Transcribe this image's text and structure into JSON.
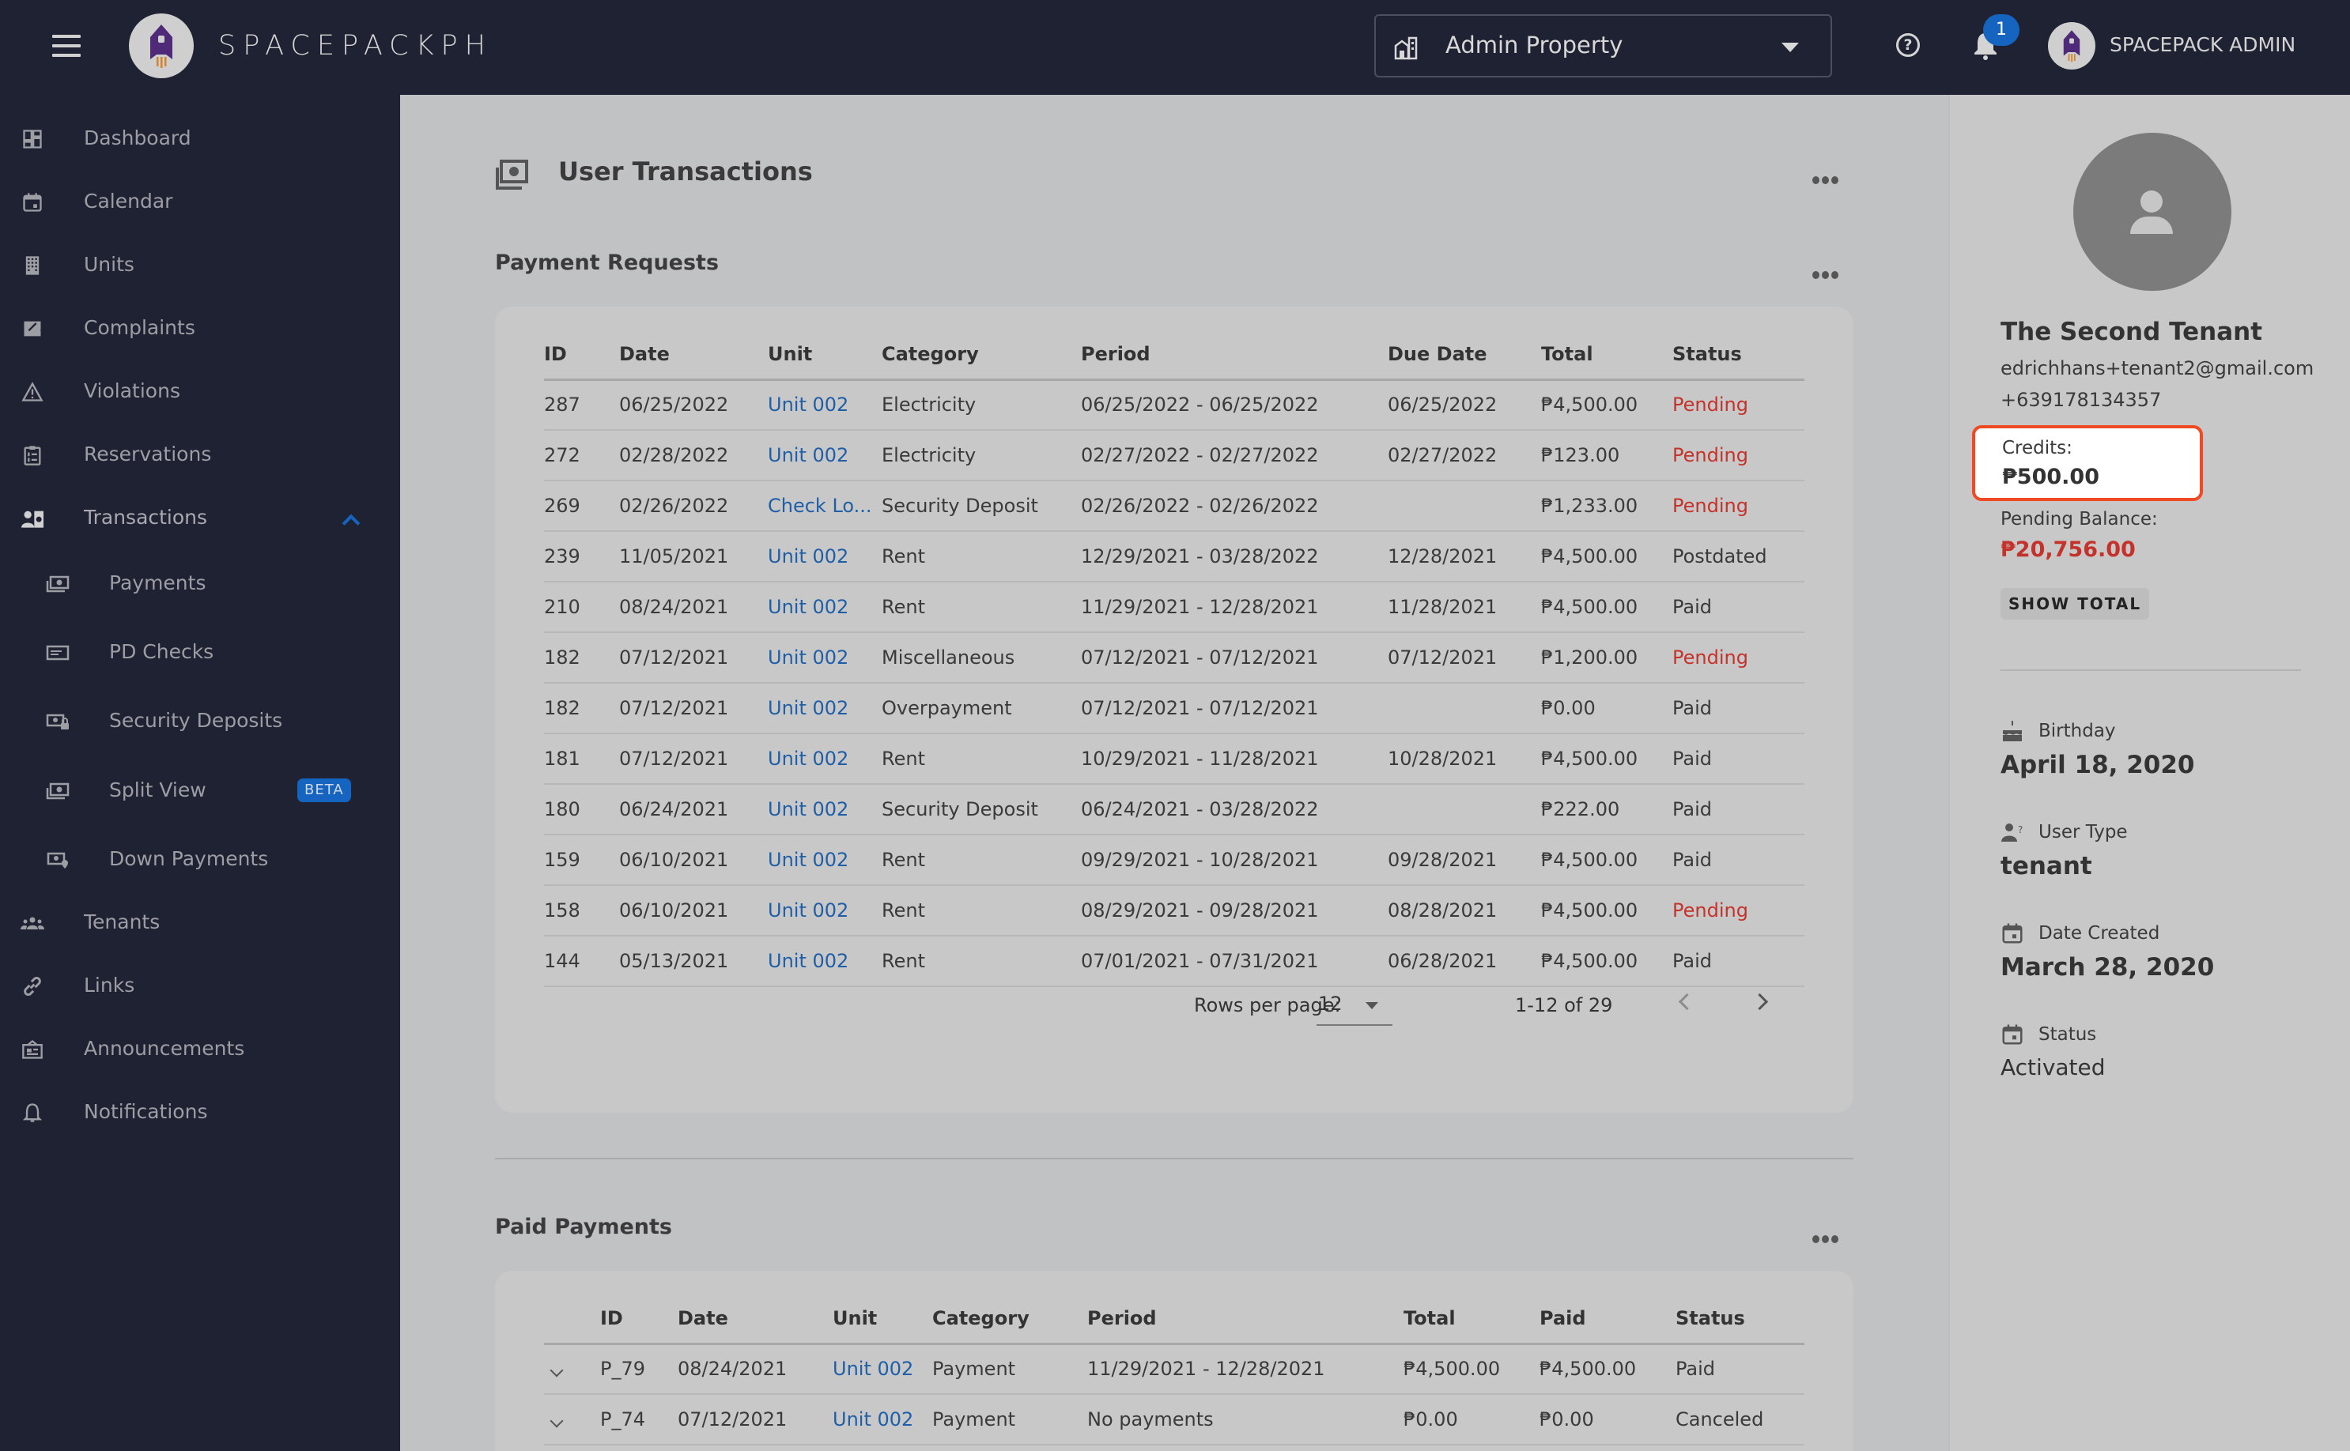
{
  "header": {
    "brand": "SPACEPACKPH",
    "property_select": {
      "value": "Admin Property"
    },
    "notification_count": "1",
    "admin_name": "SPACEPACK ADMIN",
    "help_glyph": "?"
  },
  "sidebar": {
    "items": [
      {
        "label": "Dashboard",
        "icon": "dashboard-icon"
      },
      {
        "label": "Calendar",
        "icon": "calendar-icon"
      },
      {
        "label": "Units",
        "icon": "building-icon"
      },
      {
        "label": "Complaints",
        "icon": "complaint-icon"
      },
      {
        "label": "Violations",
        "icon": "warning-icon"
      },
      {
        "label": "Reservations",
        "icon": "clipboard-list-icon"
      },
      {
        "label": "Transactions",
        "icon": "user-money-icon",
        "expanded": true
      },
      {
        "label": "Payments",
        "icon": "cash-stack-icon",
        "sub": true
      },
      {
        "label": "PD Checks",
        "icon": "check-card-icon",
        "sub": true
      },
      {
        "label": "Security Deposits",
        "icon": "cash-lock-icon",
        "sub": true
      },
      {
        "label": "Split View",
        "icon": "cash-stack-icon",
        "sub": true,
        "badge": "BETA"
      },
      {
        "label": "Down Payments",
        "icon": "cash-pin-icon",
        "sub": true
      },
      {
        "label": "Tenants",
        "icon": "people-icon"
      },
      {
        "label": "Links",
        "icon": "link-icon"
      },
      {
        "label": "Announcements",
        "icon": "announcement-icon"
      },
      {
        "label": "Notifications",
        "icon": "bell-icon"
      }
    ]
  },
  "main": {
    "title": "User Transactions",
    "payment_requests": {
      "title": "Payment Requests",
      "columns": [
        "ID",
        "Date",
        "Unit",
        "Category",
        "Period",
        "Due Date",
        "Total",
        "Status"
      ],
      "rows": [
        {
          "id": "287",
          "date": "06/25/2022",
          "unit": "Unit 002",
          "category": "Electricity",
          "period": "06/25/2022 - 06/25/2022",
          "due": "06/25/2022",
          "total": "₱4,500.00",
          "status": "Pending"
        },
        {
          "id": "272",
          "date": "02/28/2022",
          "unit": "Unit 002",
          "category": "Electricity",
          "period": "02/27/2022 - 02/27/2022",
          "due": "02/27/2022",
          "total": "₱123.00",
          "status": "Pending"
        },
        {
          "id": "269",
          "date": "02/26/2022",
          "unit": "Check Lo...",
          "category": "Security Deposit",
          "period": "02/26/2022 - 02/26/2022",
          "due": "",
          "total": "₱1,233.00",
          "status": "Pending"
        },
        {
          "id": "239",
          "date": "11/05/2021",
          "unit": "Unit 002",
          "category": "Rent",
          "period": "12/29/2021 - 03/28/2022",
          "due": "12/28/2021",
          "total": "₱4,500.00",
          "status": "Postdated"
        },
        {
          "id": "210",
          "date": "08/24/2021",
          "unit": "Unit 002",
          "category": "Rent",
          "period": "11/29/2021 - 12/28/2021",
          "due": "11/28/2021",
          "total": "₱4,500.00",
          "status": "Paid"
        },
        {
          "id": "182",
          "date": "07/12/2021",
          "unit": "Unit 002",
          "category": "Miscellaneous",
          "period": "07/12/2021 - 07/12/2021",
          "due": "07/12/2021",
          "total": "₱1,200.00",
          "status": "Pending"
        },
        {
          "id": "182",
          "date": "07/12/2021",
          "unit": "Unit 002",
          "category": "Overpayment",
          "period": "07/12/2021 - 07/12/2021",
          "due": "",
          "total": "₱0.00",
          "status": "Paid"
        },
        {
          "id": "181",
          "date": "07/12/2021",
          "unit": "Unit 002",
          "category": "Rent",
          "period": "10/29/2021 - 11/28/2021",
          "due": "10/28/2021",
          "total": "₱4,500.00",
          "status": "Paid"
        },
        {
          "id": "180",
          "date": "06/24/2021",
          "unit": "Unit 002",
          "category": "Security Deposit",
          "period": "06/24/2021 - 03/28/2022",
          "due": "",
          "total": "₱222.00",
          "status": "Paid"
        },
        {
          "id": "159",
          "date": "06/10/2021",
          "unit": "Unit 002",
          "category": "Rent",
          "period": "09/29/2021 - 10/28/2021",
          "due": "09/28/2021",
          "total": "₱4,500.00",
          "status": "Paid"
        },
        {
          "id": "158",
          "date": "06/10/2021",
          "unit": "Unit 002",
          "category": "Rent",
          "period": "08/29/2021 - 09/28/2021",
          "due": "08/28/2021",
          "total": "₱4,500.00",
          "status": "Pending"
        },
        {
          "id": "144",
          "date": "05/13/2021",
          "unit": "Unit 002",
          "category": "Rent",
          "period": "07/01/2021 - 07/31/2021",
          "due": "06/28/2021",
          "total": "₱4,500.00",
          "status": "Paid"
        }
      ],
      "pagination": {
        "rows_per_page_label": "Rows per page:",
        "rows_per_page": "12",
        "range": "1-12 of 29"
      }
    },
    "paid_payments": {
      "title": "Paid Payments",
      "columns": [
        "",
        "ID",
        "Date",
        "Unit",
        "Category",
        "Period",
        "Total",
        "Paid",
        "Status"
      ],
      "rows": [
        {
          "id": "P_79",
          "date": "08/24/2021",
          "unit": "Unit 002",
          "category": "Payment",
          "period": "11/29/2021 - 12/28/2021",
          "total": "₱4,500.00",
          "paid": "₱4,500.00",
          "status": "Paid"
        },
        {
          "id": "P_74",
          "date": "07/12/2021",
          "unit": "Unit 002",
          "category": "Payment",
          "period": "No payments",
          "total": "₱0.00",
          "paid": "₱0.00",
          "status": "Canceled"
        }
      ]
    }
  },
  "profile": {
    "name": "The Second Tenant",
    "email": "edrichhans+tenant2@gmail.com",
    "phone": "+639178134357",
    "credits_label": "Credits:",
    "credits": "₱500.00",
    "pending_label": "Pending Balance:",
    "pending": "₱20,756.00",
    "show_total_label": "SHOW TOTAL",
    "info": [
      {
        "label": "Birthday",
        "value": "April 18, 2020",
        "icon": "cake-icon"
      },
      {
        "label": "User Type",
        "value": "tenant",
        "icon": "user-question-icon"
      },
      {
        "label": "Date Created",
        "value": "March 28, 2020",
        "icon": "calendar-icon"
      },
      {
        "label": "Status",
        "value": "Activated",
        "icon": "calendar-icon"
      }
    ]
  },
  "colors": {
    "topbar_bg": "#1f2232",
    "accent_blue": "#1565c0",
    "link_blue": "#1e5fa8",
    "pending_red": "#c4332b",
    "highlight_orange": "#f04a24"
  }
}
